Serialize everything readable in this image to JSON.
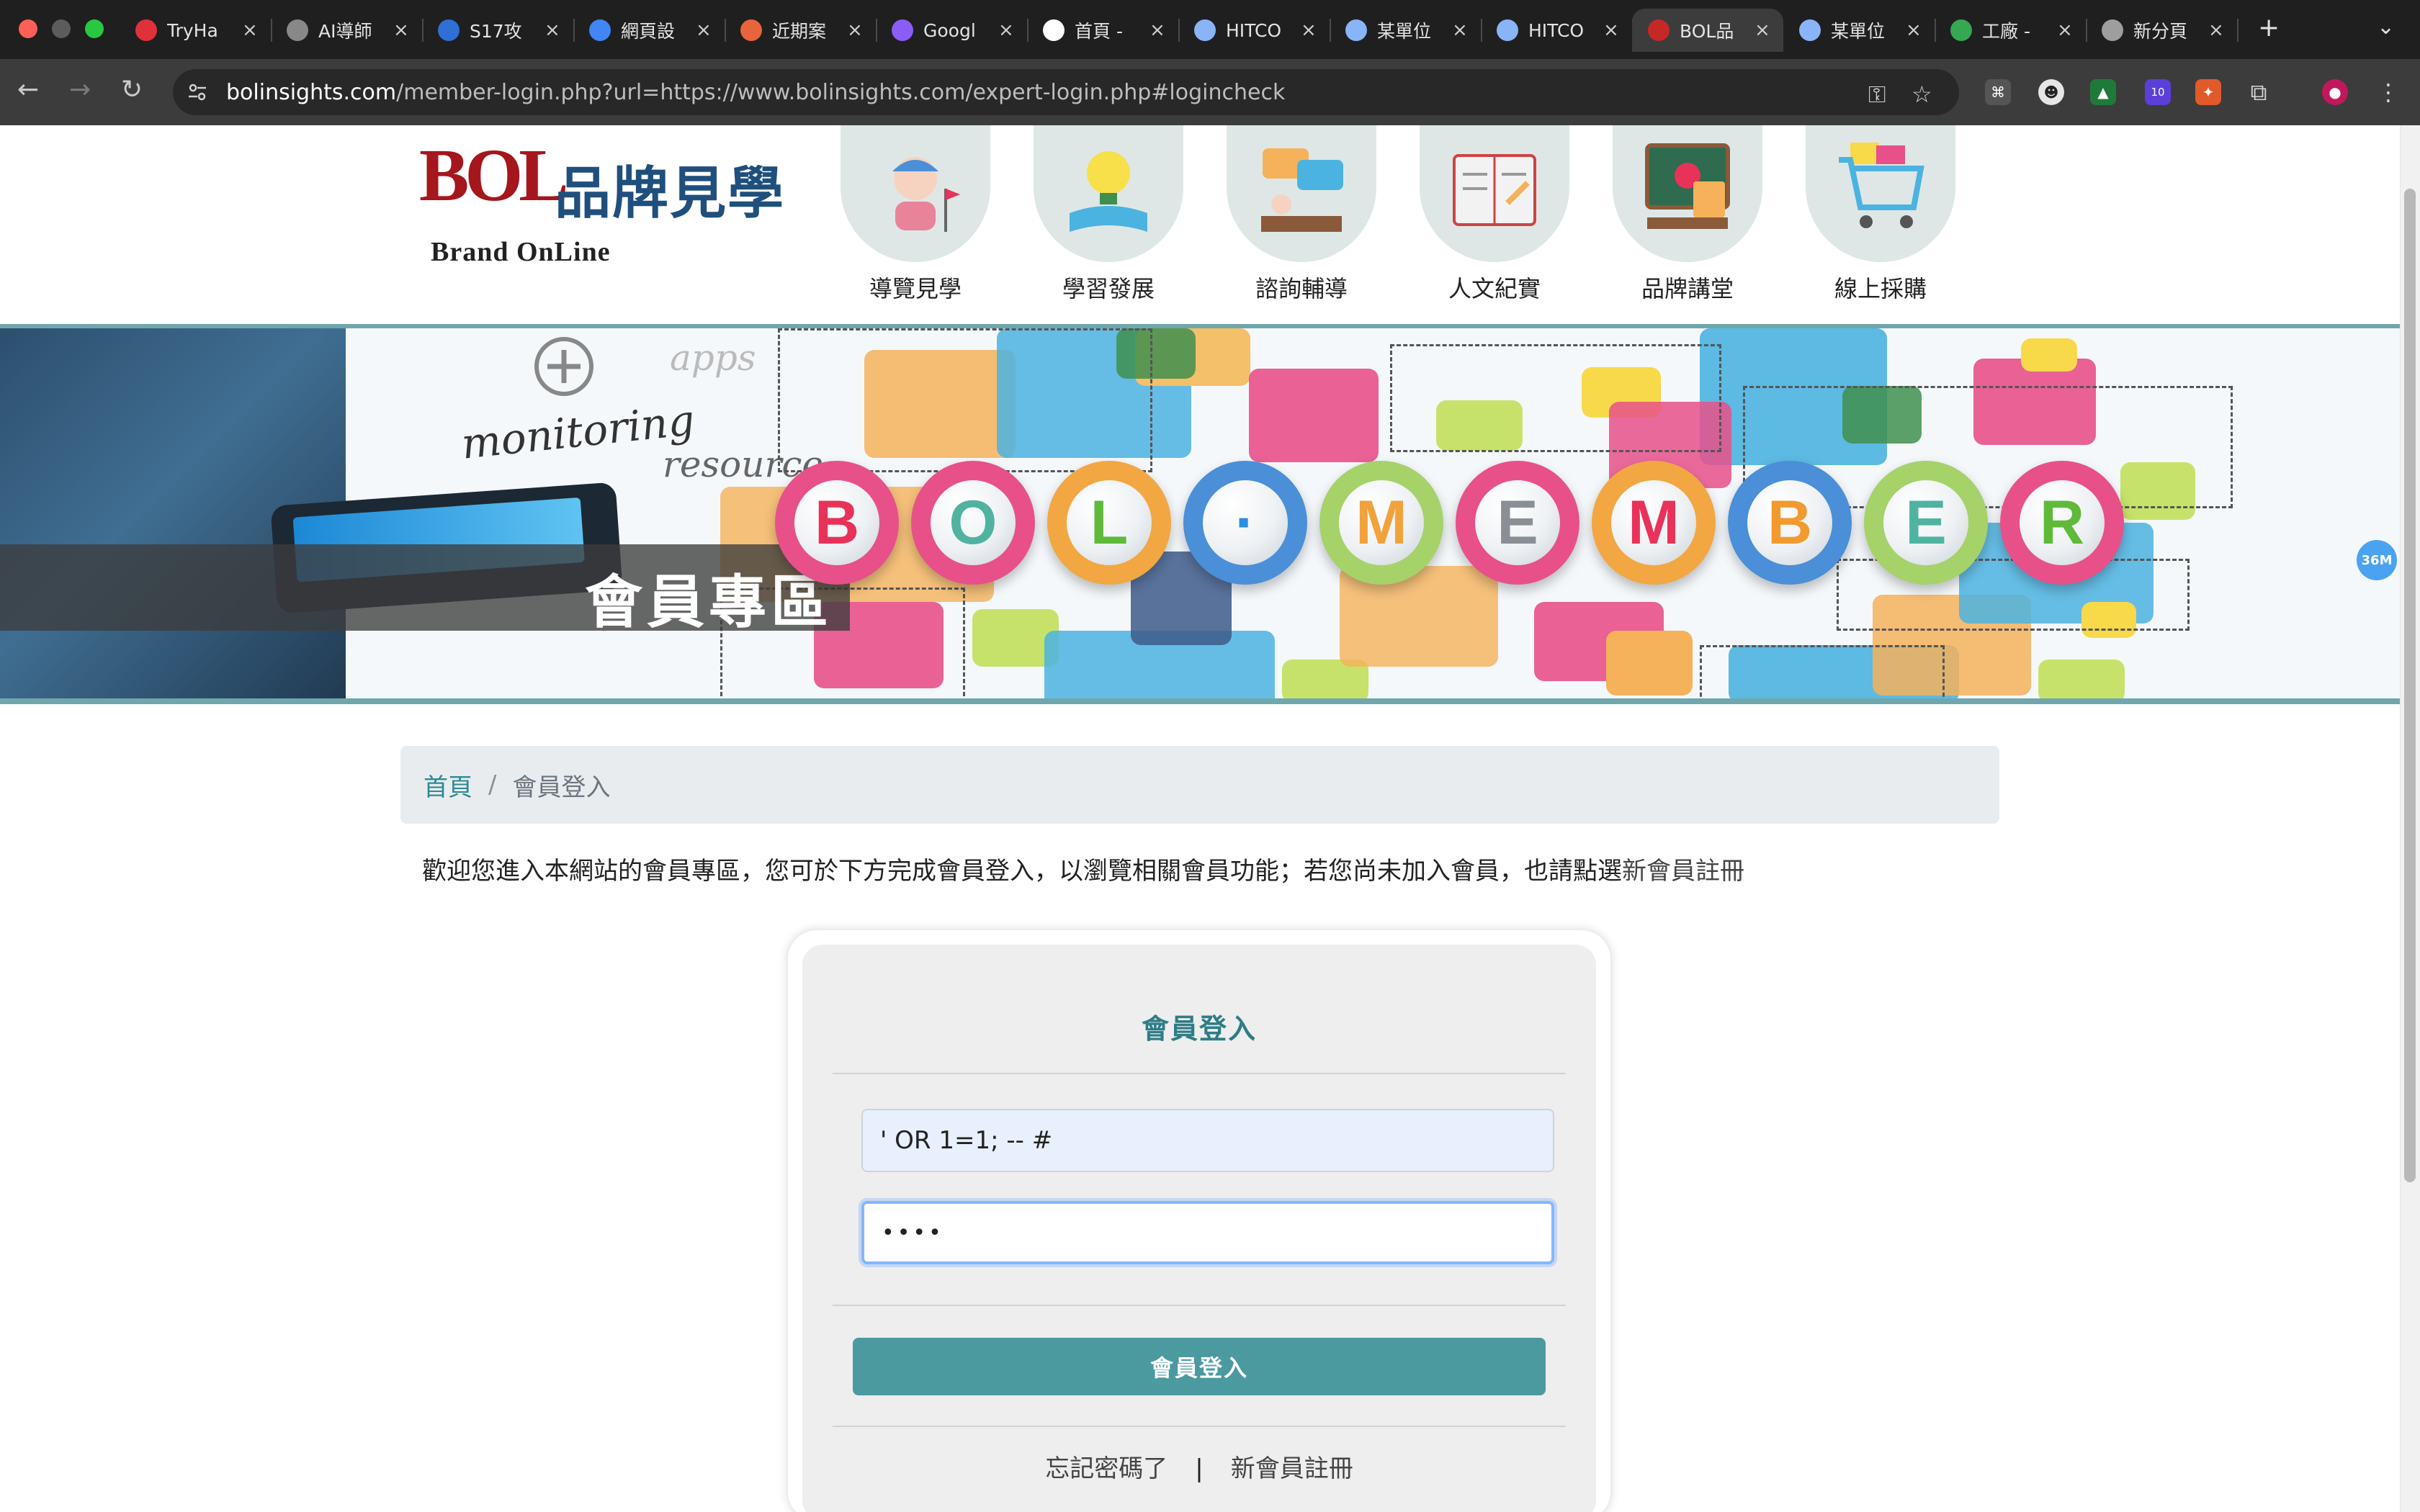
{
  "browser": {
    "tabs": [
      {
        "title": "TryHa",
        "favicon_color": "#e0303a",
        "favicon_name": "cloud-icon"
      },
      {
        "title": "AI導師",
        "favicon_color": "#888888",
        "favicon_name": "sparkle-icon"
      },
      {
        "title": "S17攻",
        "favicon_color": "#2f6fd6",
        "favicon_name": "s17-icon"
      },
      {
        "title": "網頁設",
        "favicon_color": "#4285f4",
        "favicon_name": "google-icon"
      },
      {
        "title": "近期案",
        "favicon_color": "#e8643c",
        "favicon_name": "project-icon"
      },
      {
        "title": "Googl",
        "favicon_color": "#8b5cf6",
        "favicon_name": "gemini-icon"
      },
      {
        "title": "首頁 -",
        "favicon_color": "#ffffff",
        "favicon_name": "threads-icon"
      },
      {
        "title": "HITCO",
        "favicon_color": "#8ab4f8",
        "favicon_name": "hitcon-icon"
      },
      {
        "title": "某單位",
        "favicon_color": "#8ab4f8",
        "favicon_name": "hitcon-icon"
      },
      {
        "title": "HITCO",
        "favicon_color": "#8ab4f8",
        "favicon_name": "hitcon-icon"
      },
      {
        "title": "BOL品",
        "favicon_color": "#c62828",
        "favicon_name": "bol-icon",
        "active": true
      },
      {
        "title": "某單位",
        "favicon_color": "#8ab4f8",
        "favicon_name": "hitcon-icon"
      },
      {
        "title": "工廠 -",
        "favicon_color": "#34a853",
        "favicon_name": "maps-icon"
      },
      {
        "title": "新分頁",
        "favicon_color": "#9e9e9e",
        "favicon_name": "chrome-icon"
      }
    ],
    "url_host": "bolinsights.com",
    "url_rest": "/member-login.php?url=https://www.bolinsights.com/expert-login.php#logincheck",
    "extension_badge": "10",
    "side_badge": "36M"
  },
  "site": {
    "logo_text": "BOL",
    "logo_cn": "品牌見學",
    "logo_sub": "Brand OnLine",
    "nav": [
      {
        "label": "導覽見學",
        "icon": "guide-person-icon"
      },
      {
        "label": "學習發展",
        "icon": "lightbulb-book-icon"
      },
      {
        "label": "諮詢輔導",
        "icon": "consult-chat-icon"
      },
      {
        "label": "人文紀實",
        "icon": "open-book-icon"
      },
      {
        "label": "品牌講堂",
        "icon": "lecture-board-icon"
      },
      {
        "label": "線上採購",
        "icon": "shopping-cart-icon"
      }
    ]
  },
  "banner": {
    "title": "會員專區",
    "script_monitoring": "monitoring",
    "script_resource": "resource",
    "script_apps": "apps",
    "letters": [
      {
        "char": "B",
        "ring": "#e8508a",
        "color": "#e8325a"
      },
      {
        "char": "O",
        "ring": "#e8508a",
        "color": "#4fb3a0"
      },
      {
        "char": "L",
        "ring": "#f2a742",
        "color": "#5fba3a"
      },
      {
        "char": "·",
        "ring": "#4a8fd8",
        "color": "#2a8fe0"
      },
      {
        "char": "M",
        "ring": "#a6d26a",
        "color": "#f2a23a"
      },
      {
        "char": "E",
        "ring": "#e8508a",
        "color": "#8a8f96"
      },
      {
        "char": "M",
        "ring": "#f2a742",
        "color": "#e8325a"
      },
      {
        "char": "B",
        "ring": "#4a8fd8",
        "color": "#f29a2e"
      },
      {
        "char": "E",
        "ring": "#a6d26a",
        "color": "#4fb3a0"
      },
      {
        "char": "R",
        "ring": "#e8508a",
        "color": "#5fba3a"
      }
    ]
  },
  "breadcrumb": {
    "home": "首頁",
    "separator": "/",
    "current": "會員登入"
  },
  "intro": {
    "text": "歡迎您進入本網站的會員專區，您可於下方完成會員登入，以瀏覽相關會員功能；若您尚未加入會員，也請點選",
    "register_link": "新會員註冊"
  },
  "login": {
    "title": "會員登入",
    "username_value": "' OR 1=1; -- #",
    "password_mask": "••••",
    "submit_label": "會員登入",
    "forgot_label": "忘記密碼了",
    "divider": "|",
    "register_label": "新會員註冊"
  }
}
